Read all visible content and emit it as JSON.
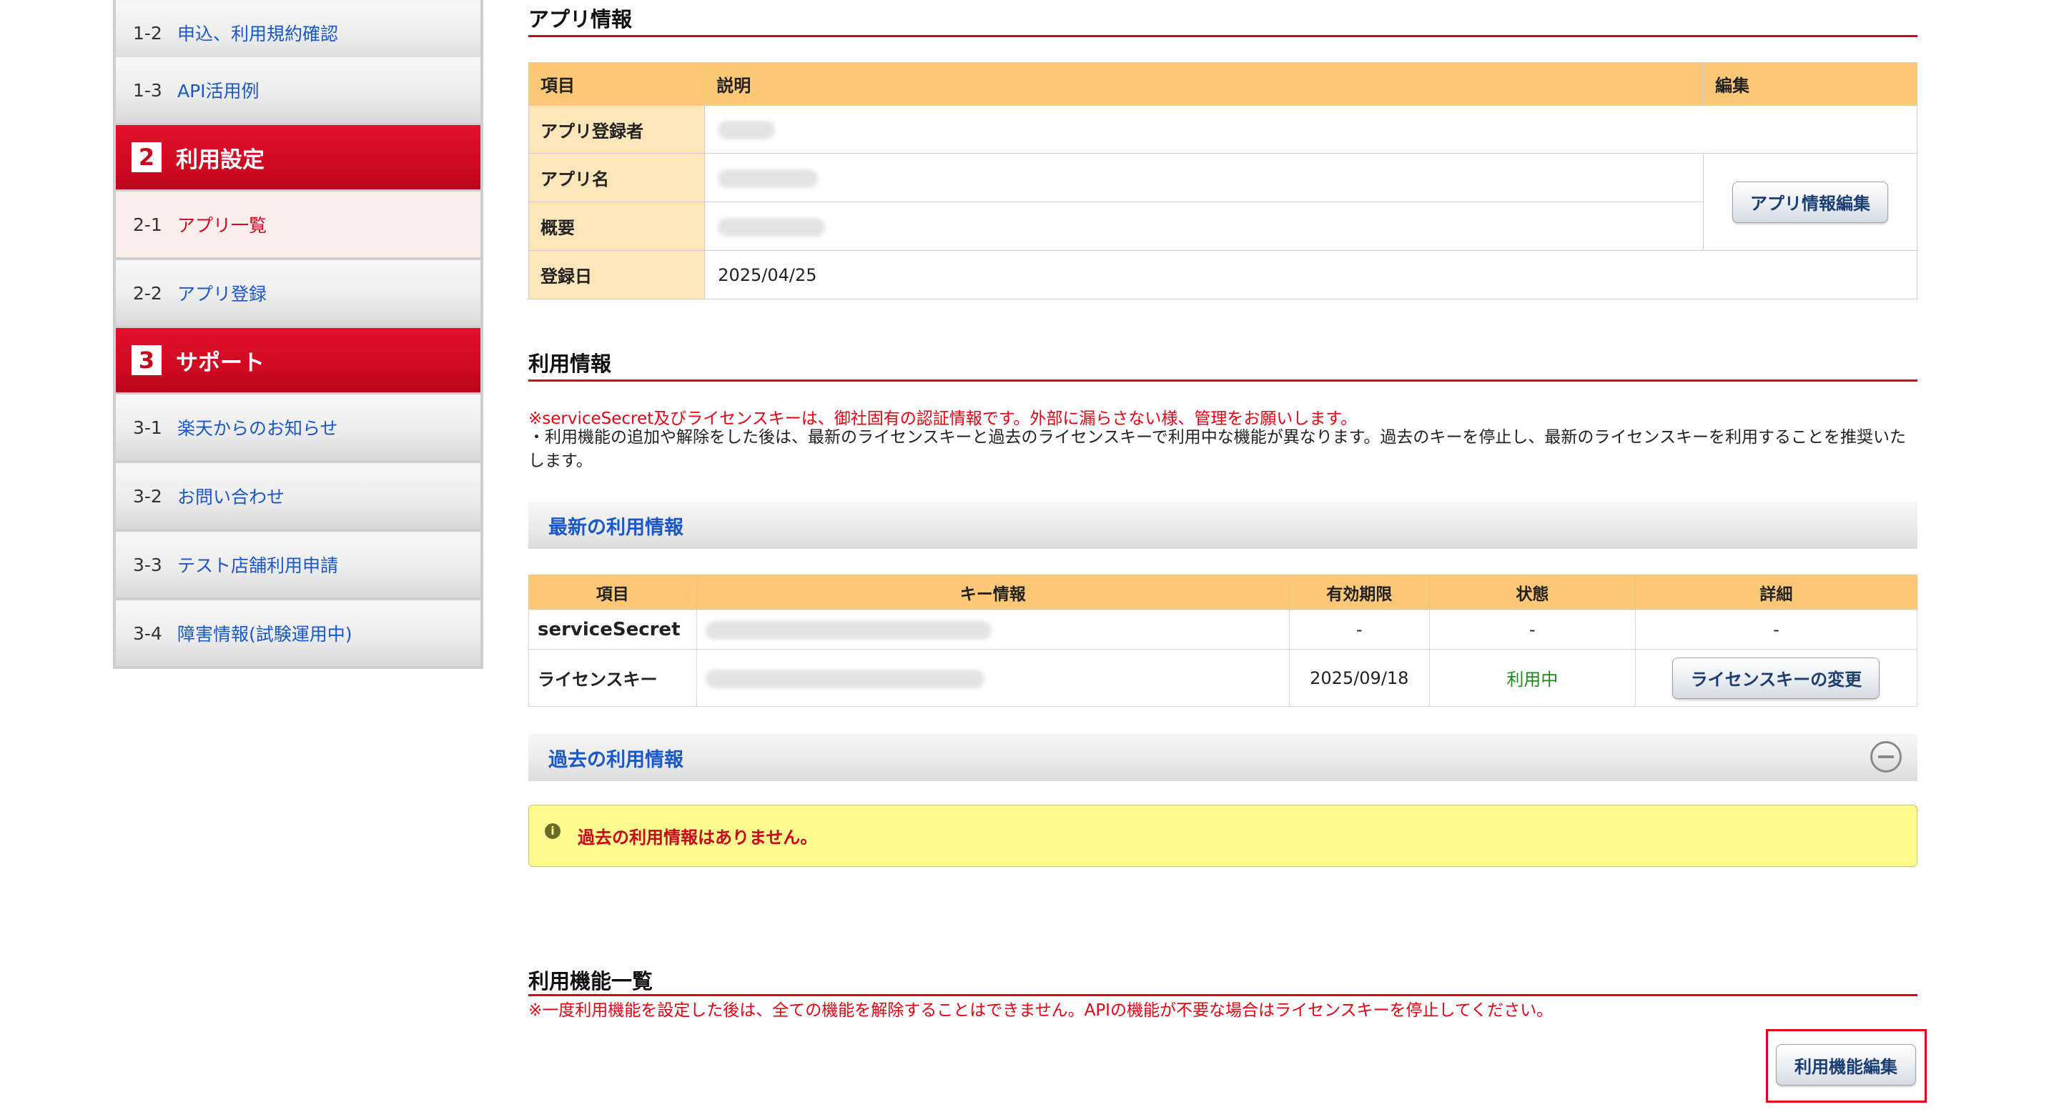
{
  "sidebar": {
    "items": [
      {
        "num": "1-2",
        "label": "申込、利用規約確認"
      },
      {
        "num": "1-3",
        "label": "API活用例"
      },
      {
        "num": "2-1",
        "label": "アプリ一覧"
      },
      {
        "num": "2-2",
        "label": "アプリ登録"
      },
      {
        "num": "3-1",
        "label": "楽天からのお知らせ"
      },
      {
        "num": "3-2",
        "label": "お問い合わせ"
      },
      {
        "num": "3-3",
        "label": "テスト店舗利用申請"
      },
      {
        "num": "3-4",
        "label": "障害情報(試験運用中)"
      }
    ],
    "sections": [
      {
        "num": "2",
        "label": "利用設定"
      },
      {
        "num": "3",
        "label": "サポート"
      }
    ],
    "active_item": "2-1"
  },
  "app_info": {
    "heading": "アプリ情報",
    "col_item": "項目",
    "col_desc": "説明",
    "col_edit": "編集",
    "rows": [
      {
        "key": "アプリ登録者"
      },
      {
        "key": "アプリ名"
      },
      {
        "key": "概要"
      },
      {
        "key": "登録日",
        "value": "2025/04/25"
      }
    ],
    "edit_button": "アプリ情報編集"
  },
  "usage_info": {
    "heading": "利用情報",
    "warning": "※serviceSecret及びライセンスキーは、御社固有の認証情報です。外部に漏らさない様、管理をお願いします。",
    "note": "・利用機能の追加や解除をした後は、最新のライセンスキーと過去のライセンスキーで利用中な機能が異なります。過去のキーを停止し、最新のライセンスキーを利用することを推奨いたします。",
    "latest_heading": "最新の利用情報",
    "columns": [
      "項目",
      "キー情報",
      "有効期限",
      "状態",
      "詳細"
    ],
    "rows": [
      {
        "key": "serviceSecret",
        "expiry": "-",
        "status": "-",
        "detail": "-"
      },
      {
        "key": "ライセンスキー",
        "expiry": "2025/09/18",
        "status": "利用中",
        "detail_button": "ライセンスキーの変更"
      }
    ],
    "status_color": "#1e8a1e",
    "past_heading": "過去の利用情報",
    "past_empty": "過去の利用情報はありません。"
  },
  "features": {
    "heading": "利用機能一覧",
    "warning": "※一度利用機能を設定した後は、全ての機能を解除することはできません。APIの機能が不要な場合はライセンスキーを停止してください。",
    "edit_button": "利用機能編集",
    "highlight_color": "#e60012"
  },
  "colors": {
    "brand_red": "#d00a21",
    "header_orange": "#fec877",
    "key_cell": "#fde6b9",
    "link_blue": "#1a57c8",
    "alert_yellow": "#fefb8e"
  }
}
